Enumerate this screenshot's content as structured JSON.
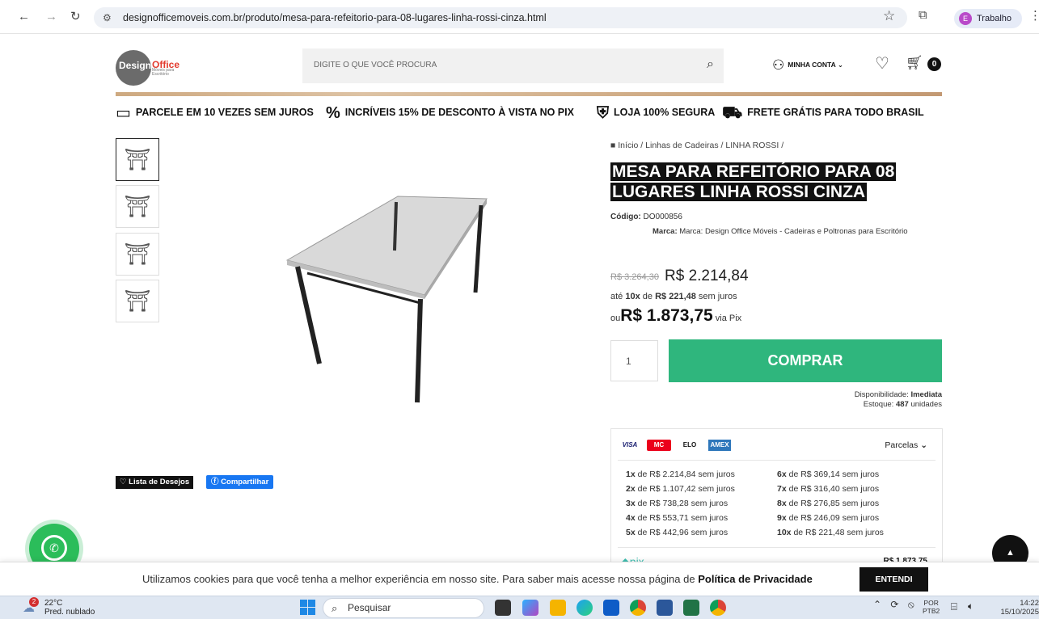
{
  "browser": {
    "url": "designofficemoveis.com.br/produto/mesa-para-refeitorio-para-08-lugares-linha-rossi-cinza.html",
    "profile_initial": "E",
    "profile_name": "Trabalho"
  },
  "header": {
    "logo_design": "Design",
    "logo_office": "Office",
    "logo_sub": "Móveis para Escritório",
    "search_placeholder": "DIGITE O QUE VOCÊ PROCURA",
    "account_label": "MINHA CONTA",
    "cart_count": "0"
  },
  "benefits": [
    {
      "icon": "credit-card-icon",
      "label": "PARCELE EM 10 VEZES SEM JUROS"
    },
    {
      "icon": "percent-icon",
      "label": "INCRÍVEIS 15% DE DESCONTO À VISTA NO PIX"
    },
    {
      "icon": "shield-lock-icon",
      "label": "LOJA 100% SEGURA"
    },
    {
      "icon": "truck-icon",
      "label": "FRETE GRÁTIS PARA TODO BRASIL"
    }
  ],
  "breadcrumb": [
    "Início",
    "Linhas de Cadeiras",
    "LINHA ROSSI"
  ],
  "product": {
    "title": "MESA PARA REFEITÓRIO PARA 08 LUGARES LINHA ROSSI CINZA",
    "code_label": "Código:",
    "code": "DO000856",
    "brand_label": "Marca:",
    "brand": "Marca: Design Office Móveis - Cadeiras e Poltronas para Escritório",
    "price_old": "R$ 3.264,30",
    "price_new": "R$ 2.214,84",
    "inst_prefix": "até",
    "inst_times": "10x",
    "inst_mid": "de",
    "inst_value": "R$ 221,48",
    "inst_suffix": "sem juros",
    "pix_prefix": "ou",
    "pix_price": "R$ 1.873,75",
    "pix_suffix": "via Pix",
    "qty": "1",
    "buy_label": "COMPRAR",
    "avail_label": "Disponibilidade:",
    "avail_value": "Imediata",
    "stock_label": "Estoque:",
    "stock_value": "487",
    "stock_unit": "unidades"
  },
  "actions": {
    "wishlist": "Lista de Desejos",
    "share": "Compartilhar"
  },
  "payment": {
    "cards": [
      "VISA",
      "MC",
      "ELO",
      "AMEX"
    ],
    "parcelas_label": "Parcelas",
    "installments": [
      {
        "n": "1x",
        "text": "de R$ 2.214,84 sem juros"
      },
      {
        "n": "2x",
        "text": "de R$ 1.107,42 sem juros"
      },
      {
        "n": "3x",
        "text": "de R$ 738,28 sem juros"
      },
      {
        "n": "4x",
        "text": "de R$ 553,71 sem juros"
      },
      {
        "n": "5x",
        "text": "de R$ 442,96 sem juros"
      },
      {
        "n": "6x",
        "text": "de R$ 369,14 sem juros"
      },
      {
        "n": "7x",
        "text": "de R$ 316,40 sem juros"
      },
      {
        "n": "8x",
        "text": "de R$ 276,85 sem juros"
      },
      {
        "n": "9x",
        "text": "de R$ 246,09 sem juros"
      },
      {
        "n": "10x",
        "text": "de R$ 221,48 sem juros"
      }
    ],
    "pix_label": "pix",
    "pix_value": "R$ 1.873,75"
  },
  "cookie": {
    "text": "Utilizamos cookies para que você tenha a melhor experiência em nosso site. Para saber mais acesse nossa página de",
    "link": "Política de Privacidade",
    "accept": "ENTENDI"
  },
  "taskbar": {
    "weather_badge": "2",
    "temp": "22°C",
    "weather": "Pred. nublado",
    "search": "Pesquisar",
    "lang1": "POR",
    "lang2": "PTB2",
    "time": "14:22",
    "date": "15/10/2025"
  }
}
